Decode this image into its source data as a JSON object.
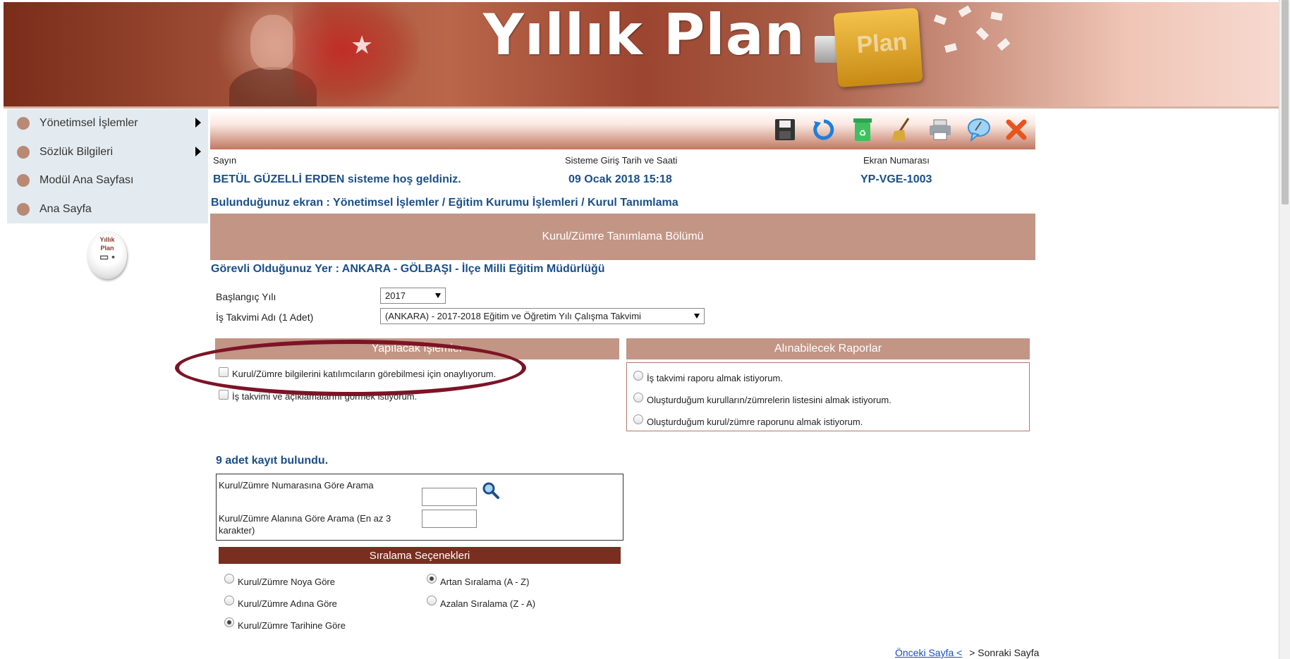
{
  "banner": {
    "title": "Yıllık Plan",
    "folder_text": "Plan"
  },
  "sidebar": {
    "items": [
      {
        "label": "Yönetimsel İşlemler",
        "has_submenu": true
      },
      {
        "label": "Sözlük Bilgileri",
        "has_submenu": true
      },
      {
        "label": "Modül Ana Sayfası",
        "has_submenu": false
      },
      {
        "label": "Ana Sayfa",
        "has_submenu": false
      }
    ],
    "logo_line1": "Yıllık",
    "logo_line2": "Plan"
  },
  "toolbar": {
    "icons": [
      "save-icon",
      "refresh-icon",
      "recycle-bin-icon",
      "broom-icon",
      "printer-icon",
      "comment-icon",
      "close-icon"
    ]
  },
  "header": {
    "greeting_label": "Sayın",
    "greeting_value": "BETÜL GÜZELLİ ERDEN sisteme hoş geldiniz.",
    "login_label": "Sisteme Giriş Tarih ve Saati",
    "login_value": "09 Ocak 2018 15:18",
    "screen_label": "Ekran Numarası",
    "screen_value": "YP-VGE-1003"
  },
  "breadcrumb": "Bulunduğunuz ekran : Yönetimsel İşlemler / Eğitim Kurumu İşlemleri / Kurul Tanımlama",
  "section_title": "Kurul/Zümre Tanımlama Bölümü",
  "location": "Görevli Olduğunuz Yer : ANKARA - GÖLBAŞI - İlçe Milli Eğitim Müdürlüğü",
  "form": {
    "year_label": "Başlangıç Yılı",
    "year_value": "2017",
    "calendar_label": "İş Takvimi Adı (1 Adet)",
    "calendar_value": "(ANKARA) - 2017-2018 Eğitim ve Öğretim Yılı Çalışma Takvimi"
  },
  "actions": {
    "title": "Yapılacak İşlemler",
    "items": [
      {
        "label": "Kurul/Zümre bilgilerini katılımcıların görebilmesi için onaylıyorum.",
        "checked": false
      },
      {
        "label": "İş takvimi ve açıklamalarını görmek istiyorum.",
        "checked": false
      }
    ]
  },
  "reports": {
    "title": "Alınabilecek Raporlar",
    "items": [
      {
        "label": "İş takvimi raporu almak istiyorum.",
        "selected": false
      },
      {
        "label": "Oluşturduğum kurulların/zümrelerin listesini almak istiyorum.",
        "selected": false
      },
      {
        "label": "Oluşturduğum kurul/zümre raporunu almak istiyorum.",
        "selected": false
      }
    ]
  },
  "results": {
    "count_text": "9 adet kayıt bulundu."
  },
  "search": {
    "by_number_label": "Kurul/Zümre Numarasına Göre Arama",
    "by_number_value": "",
    "by_area_label": "Kurul/Zümre Alanına Göre Arama (En az 3 karakter)",
    "by_area_value": ""
  },
  "sorting": {
    "title": "Sıralama Seçenekleri",
    "fields": [
      {
        "label": "Kurul/Zümre Noya Göre",
        "selected": false
      },
      {
        "label": "Kurul/Zümre Adına Göre",
        "selected": false
      },
      {
        "label": "Kurul/Zümre Tarihine Göre",
        "selected": true
      }
    ],
    "orders": [
      {
        "label": "Artan Sıralama (A - Z)",
        "selected": true
      },
      {
        "label": "Azalan Sıralama (Z - A)",
        "selected": false
      }
    ]
  },
  "pager": {
    "prev_label": "Önceki Sayfa <",
    "next_label": "> Sonraki Sayfa"
  },
  "colors": {
    "accent": "#c29585",
    "dark_accent": "#7a2e1f",
    "link": "#1b4f8a",
    "highlight_ring": "#7c1426"
  }
}
